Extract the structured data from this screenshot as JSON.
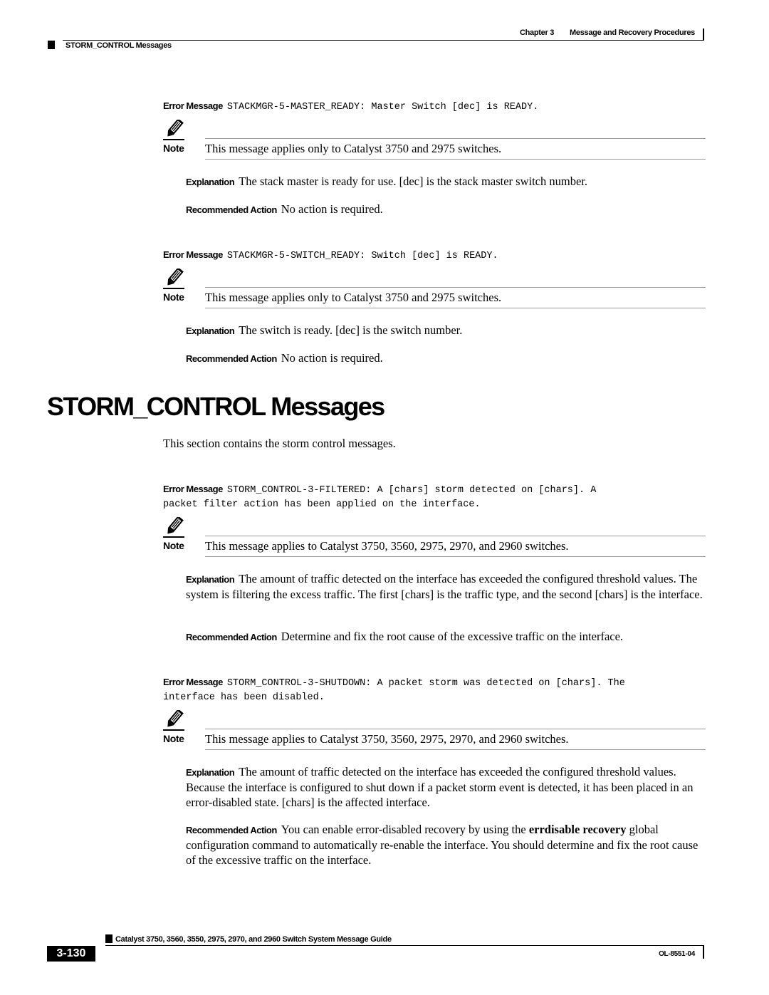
{
  "header": {
    "chapter": "Chapter 3",
    "chapter_title": "Message and Recovery Procedures",
    "section": "STORM_CONTROL Messages"
  },
  "labels": {
    "error_message": "Error Message",
    "note": "Note",
    "explanation": "Explanation",
    "recommended_action": "Recommended Action"
  },
  "messages": [
    {
      "code": "STACKMGR-5-MASTER_READY: Master Switch [dec] is READY.",
      "note": "This message applies only to Catalyst 3750 and 2975 switches.",
      "explanation": "The stack master is ready for use. [dec] is the stack master switch number.",
      "action": "No action is required."
    },
    {
      "code": "STACKMGR-5-SWITCH_READY: Switch [dec] is READY.",
      "note": "This message applies only to Catalyst 3750 and 2975 switches.",
      "explanation": "The switch is ready. [dec] is the switch number.",
      "action": "No action is required."
    },
    {
      "code_line1": "STORM_CONTROL-3-FILTERED: A [chars] storm detected on [chars]. A",
      "code_line2": "packet filter action has been applied on the interface.",
      "note": "This message applies to Catalyst 3750, 3560, 2975, 2970, and 2960 switches.",
      "explanation": "The amount of traffic detected on the interface has exceeded the configured threshold values. The system is filtering the excess traffic. The first [chars] is the traffic type, and the second [chars] is the interface.",
      "action": "Determine and fix the root cause of the excessive traffic on the interface."
    },
    {
      "code_line1": "STORM_CONTROL-3-SHUTDOWN: A packet storm was detected on [chars]. The",
      "code_line2": "interface has been disabled.",
      "note": "This message applies to Catalyst 3750, 3560, 2975, 2970, and 2960 switches.",
      "explanation": "The amount of traffic detected on the interface has exceeded the configured threshold values. Because the interface is configured to shut down if a packet storm event is detected, it has been placed in an error-disabled state. [chars] is the affected interface.",
      "action_pre": "You can enable error-disabled recovery by using the",
      "action_cmd": "errdisable recovery",
      "action_post": "global configuration command to automatically re-enable the interface. You should determine and fix the root cause of the excessive traffic on the interface."
    }
  ],
  "section": {
    "title": "STORM_CONTROL Messages",
    "intro": "This section contains the storm control messages."
  },
  "footer": {
    "guide_title": "Catalyst 3750, 3560, 3550, 2975, 2970, and 2960 Switch System Message Guide",
    "page_number": "3-130",
    "doc_id": "OL-8551-04"
  }
}
